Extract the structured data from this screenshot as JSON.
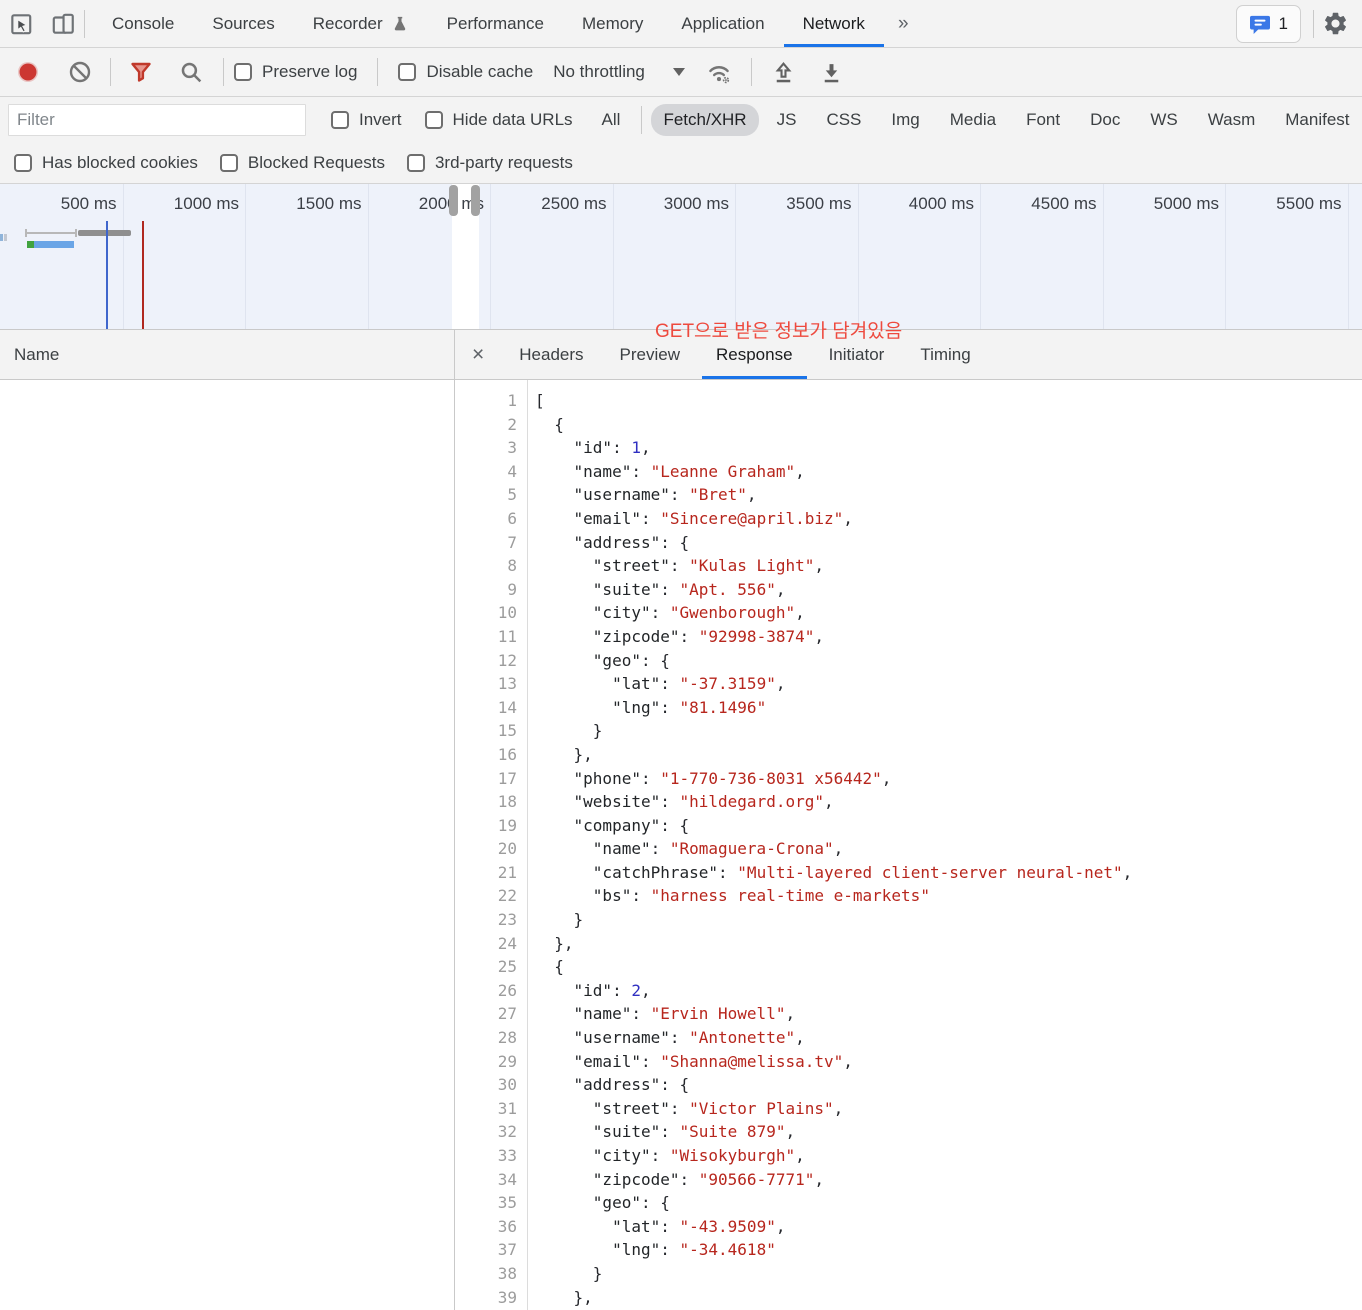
{
  "devtools_tabs": {
    "items": [
      {
        "label": "Console"
      },
      {
        "label": "Sources"
      },
      {
        "label": "Recorder",
        "flask": true
      },
      {
        "label": "Performance"
      },
      {
        "label": "Memory"
      },
      {
        "label": "Application"
      },
      {
        "label": "Network"
      }
    ],
    "active": "Network",
    "overflow_label": "»",
    "issues_count": "1"
  },
  "network_toolbar": {
    "preserve_log": "Preserve log",
    "disable_cache": "Disable cache",
    "throttling_label": "No throttling"
  },
  "filter_bar": {
    "placeholder": "Filter",
    "invert_label": "Invert",
    "hide_data_urls_label": "Hide data URLs",
    "types": [
      "All",
      "Fetch/XHR",
      "JS",
      "CSS",
      "Img",
      "Media",
      "Font",
      "Doc",
      "WS",
      "Wasm",
      "Manifest"
    ],
    "active_type": "Fetch/XHR"
  },
  "advanced_filters": [
    "Has blocked cookies",
    "Blocked Requests",
    "3rd-party requests"
  ],
  "timeline": {
    "ticks": [
      "500 ms",
      "1000 ms",
      "1500 ms",
      "2000 ms",
      "2500 ms",
      "3000 ms",
      "3500 ms",
      "4000 ms",
      "4500 ms",
      "5000 ms",
      "5500 ms"
    ]
  },
  "request_table": {
    "name_header": "Name"
  },
  "detail_panel": {
    "close_label": "×",
    "tabs": [
      "Headers",
      "Preview",
      "Response",
      "Initiator",
      "Timing"
    ],
    "active_tab": "Response"
  },
  "annotation": {
    "text": "GET으로 받은 정보가 담겨있음",
    "color": "#ee4a3e"
  },
  "colors": {
    "accent_blue": "#1a73e8",
    "record_red": "#cc3732",
    "filter_funnel_red": "#c0392b",
    "string_red": "#b7261d",
    "number_blue": "#2f2fc1",
    "timeline_bg": "#eef2fa"
  },
  "response": {
    "lines": [
      [
        [
          "pl",
          "["
        ]
      ],
      [
        [
          "pl",
          "  {"
        ]
      ],
      [
        [
          "pl",
          "    "
        ],
        [
          "key",
          "\"id\""
        ],
        [
          "pl",
          ": "
        ],
        [
          "num",
          "1"
        ],
        [
          "pl",
          ","
        ]
      ],
      [
        [
          "pl",
          "    "
        ],
        [
          "key",
          "\"name\""
        ],
        [
          "pl",
          ": "
        ],
        [
          "str",
          "\"Leanne Graham\""
        ],
        [
          "pl",
          ","
        ]
      ],
      [
        [
          "pl",
          "    "
        ],
        [
          "key",
          "\"username\""
        ],
        [
          "pl",
          ": "
        ],
        [
          "str",
          "\"Bret\""
        ],
        [
          "pl",
          ","
        ]
      ],
      [
        [
          "pl",
          "    "
        ],
        [
          "key",
          "\"email\""
        ],
        [
          "pl",
          ": "
        ],
        [
          "str",
          "\"Sincere@april.biz\""
        ],
        [
          "pl",
          ","
        ]
      ],
      [
        [
          "pl",
          "    "
        ],
        [
          "key",
          "\"address\""
        ],
        [
          "pl",
          ": {"
        ]
      ],
      [
        [
          "pl",
          "      "
        ],
        [
          "key",
          "\"street\""
        ],
        [
          "pl",
          ": "
        ],
        [
          "str",
          "\"Kulas Light\""
        ],
        [
          "pl",
          ","
        ]
      ],
      [
        [
          "pl",
          "      "
        ],
        [
          "key",
          "\"suite\""
        ],
        [
          "pl",
          ": "
        ],
        [
          "str",
          "\"Apt. 556\""
        ],
        [
          "pl",
          ","
        ]
      ],
      [
        [
          "pl",
          "      "
        ],
        [
          "key",
          "\"city\""
        ],
        [
          "pl",
          ": "
        ],
        [
          "str",
          "\"Gwenborough\""
        ],
        [
          "pl",
          ","
        ]
      ],
      [
        [
          "pl",
          "      "
        ],
        [
          "key",
          "\"zipcode\""
        ],
        [
          "pl",
          ": "
        ],
        [
          "str",
          "\"92998-3874\""
        ],
        [
          "pl",
          ","
        ]
      ],
      [
        [
          "pl",
          "      "
        ],
        [
          "key",
          "\"geo\""
        ],
        [
          "pl",
          ": {"
        ]
      ],
      [
        [
          "pl",
          "        "
        ],
        [
          "key",
          "\"lat\""
        ],
        [
          "pl",
          ": "
        ],
        [
          "str",
          "\"-37.3159\""
        ],
        [
          "pl",
          ","
        ]
      ],
      [
        [
          "pl",
          "        "
        ],
        [
          "key",
          "\"lng\""
        ],
        [
          "pl",
          ": "
        ],
        [
          "str",
          "\"81.1496\""
        ]
      ],
      [
        [
          "pl",
          "      }"
        ]
      ],
      [
        [
          "pl",
          "    },"
        ]
      ],
      [
        [
          "pl",
          "    "
        ],
        [
          "key",
          "\"phone\""
        ],
        [
          "pl",
          ": "
        ],
        [
          "str",
          "\"1-770-736-8031 x56442\""
        ],
        [
          "pl",
          ","
        ]
      ],
      [
        [
          "pl",
          "    "
        ],
        [
          "key",
          "\"website\""
        ],
        [
          "pl",
          ": "
        ],
        [
          "str",
          "\"hildegard.org\""
        ],
        [
          "pl",
          ","
        ]
      ],
      [
        [
          "pl",
          "    "
        ],
        [
          "key",
          "\"company\""
        ],
        [
          "pl",
          ": {"
        ]
      ],
      [
        [
          "pl",
          "      "
        ],
        [
          "key",
          "\"name\""
        ],
        [
          "pl",
          ": "
        ],
        [
          "str",
          "\"Romaguera-Crona\""
        ],
        [
          "pl",
          ","
        ]
      ],
      [
        [
          "pl",
          "      "
        ],
        [
          "key",
          "\"catchPhrase\""
        ],
        [
          "pl",
          ": "
        ],
        [
          "str",
          "\"Multi-layered client-server neural-net\""
        ],
        [
          "pl",
          ","
        ]
      ],
      [
        [
          "pl",
          "      "
        ],
        [
          "key",
          "\"bs\""
        ],
        [
          "pl",
          ": "
        ],
        [
          "str",
          "\"harness real-time e-markets\""
        ]
      ],
      [
        [
          "pl",
          "    }"
        ]
      ],
      [
        [
          "pl",
          "  },"
        ]
      ],
      [
        [
          "pl",
          "  {"
        ]
      ],
      [
        [
          "pl",
          "    "
        ],
        [
          "key",
          "\"id\""
        ],
        [
          "pl",
          ": "
        ],
        [
          "num",
          "2"
        ],
        [
          "pl",
          ","
        ]
      ],
      [
        [
          "pl",
          "    "
        ],
        [
          "key",
          "\"name\""
        ],
        [
          "pl",
          ": "
        ],
        [
          "str",
          "\"Ervin Howell\""
        ],
        [
          "pl",
          ","
        ]
      ],
      [
        [
          "pl",
          "    "
        ],
        [
          "key",
          "\"username\""
        ],
        [
          "pl",
          ": "
        ],
        [
          "str",
          "\"Antonette\""
        ],
        [
          "pl",
          ","
        ]
      ],
      [
        [
          "pl",
          "    "
        ],
        [
          "key",
          "\"email\""
        ],
        [
          "pl",
          ": "
        ],
        [
          "str",
          "\"Shanna@melissa.tv\""
        ],
        [
          "pl",
          ","
        ]
      ],
      [
        [
          "pl",
          "    "
        ],
        [
          "key",
          "\"address\""
        ],
        [
          "pl",
          ": {"
        ]
      ],
      [
        [
          "pl",
          "      "
        ],
        [
          "key",
          "\"street\""
        ],
        [
          "pl",
          ": "
        ],
        [
          "str",
          "\"Victor Plains\""
        ],
        [
          "pl",
          ","
        ]
      ],
      [
        [
          "pl",
          "      "
        ],
        [
          "key",
          "\"suite\""
        ],
        [
          "pl",
          ": "
        ],
        [
          "str",
          "\"Suite 879\""
        ],
        [
          "pl",
          ","
        ]
      ],
      [
        [
          "pl",
          "      "
        ],
        [
          "key",
          "\"city\""
        ],
        [
          "pl",
          ": "
        ],
        [
          "str",
          "\"Wisokyburgh\""
        ],
        [
          "pl",
          ","
        ]
      ],
      [
        [
          "pl",
          "      "
        ],
        [
          "key",
          "\"zipcode\""
        ],
        [
          "pl",
          ": "
        ],
        [
          "str",
          "\"90566-7771\""
        ],
        [
          "pl",
          ","
        ]
      ],
      [
        [
          "pl",
          "      "
        ],
        [
          "key",
          "\"geo\""
        ],
        [
          "pl",
          ": {"
        ]
      ],
      [
        [
          "pl",
          "        "
        ],
        [
          "key",
          "\"lat\""
        ],
        [
          "pl",
          ": "
        ],
        [
          "str",
          "\"-43.9509\""
        ],
        [
          "pl",
          ","
        ]
      ],
      [
        [
          "pl",
          "        "
        ],
        [
          "key",
          "\"lng\""
        ],
        [
          "pl",
          ": "
        ],
        [
          "str",
          "\"-34.4618\""
        ]
      ],
      [
        [
          "pl",
          "      }"
        ]
      ],
      [
        [
          "pl",
          "    },"
        ]
      ]
    ]
  }
}
